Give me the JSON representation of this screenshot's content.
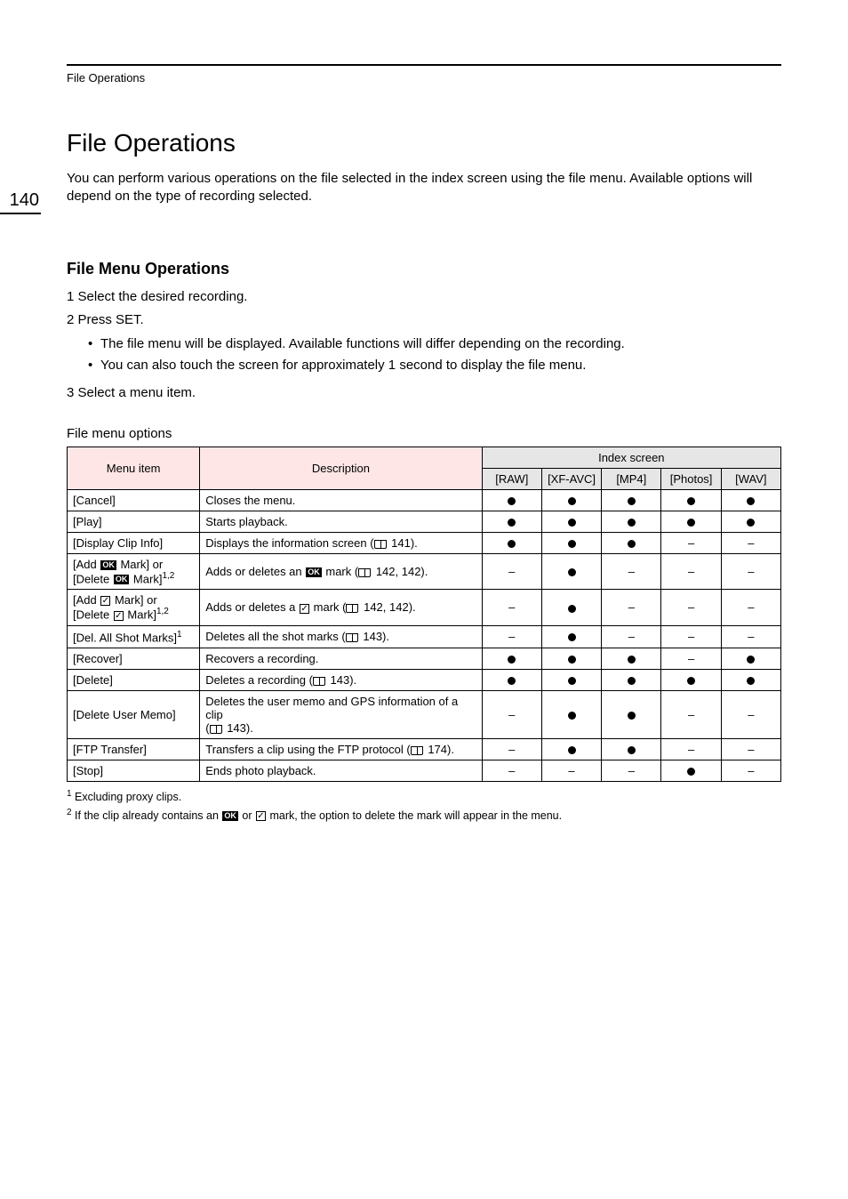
{
  "running_head": "File Operations",
  "page_number": "140",
  "title": "File Operations",
  "intro": "You can perform various operations on the file selected in the index screen using the file menu. Available options will depend on the type of recording selected.",
  "section_heading": "File Menu Operations",
  "steps": {
    "s1": "1 Select the desired recording.",
    "s2": "2 Press SET.",
    "s2_b1": "The file menu will be displayed. Available functions will differ depending on the recording.",
    "s2_b2": "You can also touch the screen for approximately 1 second to display the file menu.",
    "s3": "3 Select a menu item."
  },
  "table_caption": "File menu options",
  "columns": {
    "menu_item": "Menu item",
    "description": "Description",
    "index_screen": "Index screen",
    "raw": "[RAW]",
    "xfavc": "[XF-AVC]",
    "mp4": "[MP4]",
    "photos": "[Photos]",
    "wav": "[WAV]"
  },
  "rows": [
    {
      "name": "[Cancel]",
      "desc": "Closes the menu.",
      "raw": "dot",
      "xfavc": "dot",
      "mp4": "dot",
      "photos": "dot",
      "wav": "dot"
    },
    {
      "name": "[Play]",
      "desc": "Starts playback.",
      "raw": "dot",
      "xfavc": "dot",
      "mp4": "dot",
      "photos": "dot",
      "wav": "dot"
    },
    {
      "name": "[Display Clip Info]",
      "desc_prefix": "Displays the information screen (",
      "desc_ref": "141",
      "desc_suffix": ").",
      "raw": "dot",
      "xfavc": "dot",
      "mp4": "dot",
      "photos": "dash",
      "wav": "dash"
    },
    {
      "name_l1_pre": "[Add ",
      "name_l1_post": " Mark] or",
      "name_l2_pre": "[Delete ",
      "name_l2_post": " Mark]",
      "name_sup": "1,2",
      "icon": "ok",
      "desc_pre": "Adds or deletes an ",
      "desc_mid": " mark (",
      "desc_ref": "142, 142",
      "desc_suffix": ").",
      "raw": "dash",
      "xfavc": "dot",
      "mp4": "dash",
      "photos": "dash",
      "wav": "dash"
    },
    {
      "name_l1_pre": "[Add ",
      "name_l1_post": " Mark] or",
      "name_l2_pre": "[Delete ",
      "name_l2_post": " Mark]",
      "name_sup": "1,2",
      "icon": "check",
      "desc_pre": "Adds or deletes a ",
      "desc_mid": " mark (",
      "desc_ref": "142, 142",
      "desc_suffix": ").",
      "raw": "dash",
      "xfavc": "dot",
      "mp4": "dash",
      "photos": "dash",
      "wav": "dash"
    },
    {
      "name": "[Del. All Shot Marks]",
      "name_sup": "1",
      "desc_prefix": "Deletes all the shot marks (",
      "desc_ref": "143",
      "desc_suffix": ").",
      "raw": "dash",
      "xfavc": "dot",
      "mp4": "dash",
      "photos": "dash",
      "wav": "dash"
    },
    {
      "name": "[Recover]",
      "desc": "Recovers a recording.",
      "raw": "dot",
      "xfavc": "dot",
      "mp4": "dot",
      "photos": "dash",
      "wav": "dot"
    },
    {
      "name": "[Delete]",
      "desc_prefix": "Deletes a recording (",
      "desc_ref": "143",
      "desc_suffix": ").",
      "raw": "dot",
      "xfavc": "dot",
      "mp4": "dot",
      "photos": "dot",
      "wav": "dot"
    },
    {
      "name": "[Delete User Memo]",
      "desc_l1": "Deletes the user memo and GPS information of a clip",
      "desc_l2_pre": "(",
      "desc_ref": "143",
      "desc_suffix": ").",
      "raw": "dash",
      "xfavc": "dot",
      "mp4": "dot",
      "photos": "dash",
      "wav": "dash"
    },
    {
      "name": "[FTP Transfer]",
      "desc_prefix": "Transfers a clip using the FTP protocol (",
      "desc_ref": "174",
      "desc_suffix": ").",
      "raw": "dash",
      "xfavc": "dot",
      "mp4": "dot",
      "photos": "dash",
      "wav": "dash"
    },
    {
      "name": "[Stop]",
      "desc": "Ends photo playback.",
      "raw": "dash",
      "xfavc": "dash",
      "mp4": "dash",
      "photos": "dot",
      "wav": "dash"
    }
  ],
  "footnotes": {
    "f1": " Excluding proxy clips.",
    "f2_pre": " If the clip already contains an ",
    "f2_mid": " or ",
    "f2_post": " mark, the option to delete the mark will appear in the menu."
  }
}
